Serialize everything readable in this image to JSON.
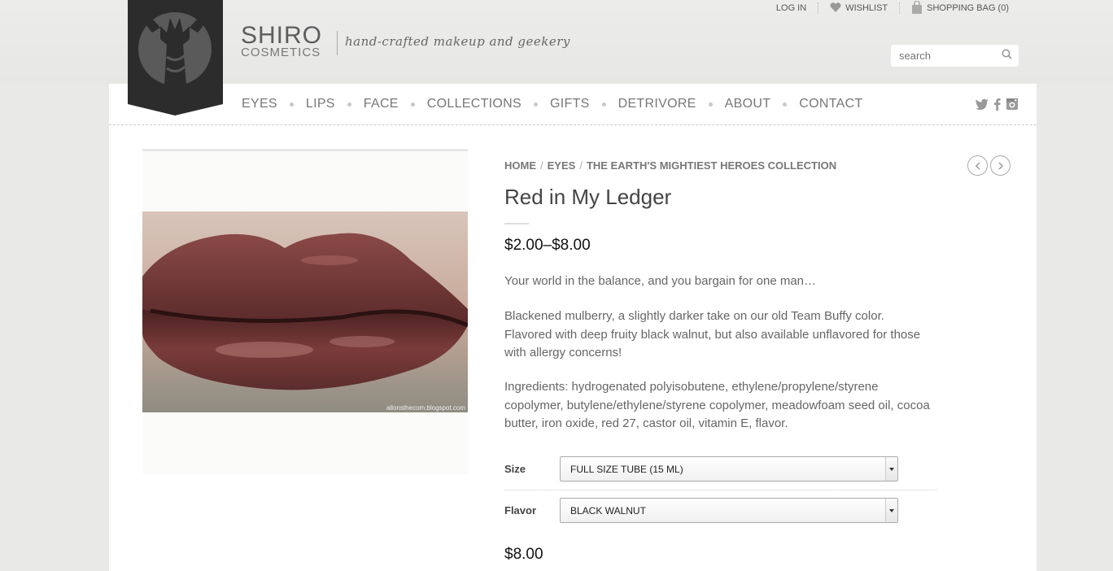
{
  "brand": {
    "name": "SHIRO",
    "subtitle": "COSMETICS",
    "tagline": "hand-crafted makeup and geekery"
  },
  "utility": {
    "login": "LOG IN",
    "wishlist": "WISHLIST",
    "bag": "SHOPPING BAG (0)"
  },
  "search": {
    "placeholder": "search"
  },
  "nav": {
    "items": [
      "EYES",
      "LIPS",
      "FACE",
      "COLLECTIONS",
      "GIFTS",
      "DETRIVORE",
      "ABOUT",
      "CONTACT"
    ]
  },
  "social": [
    "twitter-icon",
    "facebook-icon",
    "instagram-icon"
  ],
  "breadcrumb": {
    "home": "HOME",
    "category": "EYES",
    "collection": "THE EARTH'S MIGHTIEST HEROES COLLECTION"
  },
  "product": {
    "title": "Red in My Ledger",
    "price_range": "$2.00–$8.00",
    "quote": "Your world in the balance, and you bargain for one man…",
    "description": "Blackened mulberry, a slightly darker take on our old Team Buffy color. Flavored with deep fruity black walnut, but also available unflavored for those with allergy concerns!",
    "ingredients": "Ingredients: hydrogenated polyisobutene, ethylene/propylene/styrene copolymer, butylene/ethylene/styrene copolymer, meadowfoam seed oil, cocoa butter, iron oxide, red 27, castor oil, vitamin E, flavor.",
    "image_credit": "allonsthecom.blogspot.com",
    "variant_price": "$8.00"
  },
  "options": {
    "size": {
      "label": "Size",
      "value": "FULL SIZE TUBE (15 ML)"
    },
    "flavor": {
      "label": "Flavor",
      "value": "BLACK WALNUT"
    }
  },
  "colors": {
    "badge": "#2c2c2c",
    "lip": "#6e3432"
  }
}
